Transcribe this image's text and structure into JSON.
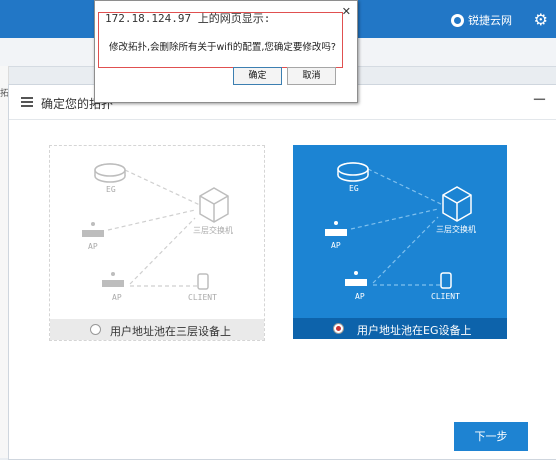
{
  "header": {
    "brand": "锐捷云网",
    "gear_icon": "gear-icon"
  },
  "leftstrip": {
    "label": "拓"
  },
  "modal": {
    "title": "确定您的拓扑",
    "options": [
      {
        "nodes": {
          "eg": "EG",
          "ap1": "AP",
          "ap2": "AP",
          "switch": "三层交换机",
          "client": "CLIENT"
        },
        "label": "用户地址池在三层设备上",
        "selected": false
      },
      {
        "nodes": {
          "eg": "EG",
          "ap1": "AP",
          "ap2": "AP",
          "switch": "三层交换机",
          "client": "CLIENT"
        },
        "label": "用户地址池在EG设备上",
        "selected": true
      }
    ],
    "next_label": "下一步"
  },
  "alert": {
    "title": "172.18.124.97 上的网页显示:",
    "message": "修改拓扑,会删除所有关于wifi的配置,您确定要修改吗?",
    "ok_label": "确定",
    "cancel_label": "取消"
  },
  "colors": {
    "topbar": "#2277c6",
    "selected_card": "#1c84d3",
    "button": "#1e83d2"
  }
}
